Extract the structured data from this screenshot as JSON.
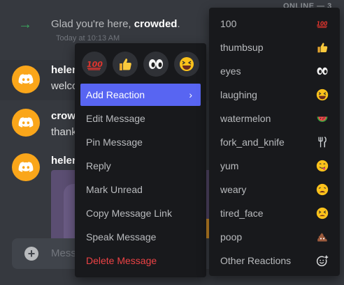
{
  "channel": {
    "online_header": "ONLINE — 3",
    "system_message": {
      "prefix": "Glad you're here, ",
      "username": "crowded",
      "suffix": ".",
      "timestamp": "Today at 10:13 AM"
    },
    "messages": [
      {
        "author": "helen",
        "body": "welco"
      },
      {
        "author": "crow",
        "body": "thank"
      },
      {
        "author": "heler",
        "body": ""
      }
    ],
    "composer_placeholder": "Messa"
  },
  "context_menu": {
    "quick_reactions": [
      "100-emoji",
      "thumbsup-emoji",
      "eyes-emoji",
      "laughing-emoji"
    ],
    "items": [
      {
        "label": "Add Reaction",
        "active": true,
        "has_submenu": true
      },
      {
        "label": "Edit Message"
      },
      {
        "label": "Pin Message"
      },
      {
        "label": "Reply"
      },
      {
        "label": "Mark Unread"
      },
      {
        "label": "Copy Message Link"
      },
      {
        "label": "Speak Message"
      },
      {
        "label": "Delete Message",
        "danger": true
      }
    ]
  },
  "reaction_submenu": {
    "items": [
      {
        "label": "100",
        "icon": "100-emoji"
      },
      {
        "label": "thumbsup",
        "icon": "thumbsup-emoji"
      },
      {
        "label": "eyes",
        "icon": "eyes-emoji"
      },
      {
        "label": "laughing",
        "icon": "laughing-emoji"
      },
      {
        "label": "watermelon",
        "icon": "watermelon-emoji"
      },
      {
        "label": "fork_and_knife",
        "icon": "fork-and-knife-emoji"
      },
      {
        "label": "yum",
        "icon": "yum-emoji"
      },
      {
        "label": "weary",
        "icon": "weary-emoji"
      },
      {
        "label": "tired_face",
        "icon": "tired-face-emoji"
      },
      {
        "label": "poop",
        "icon": "poop-emoji"
      },
      {
        "label": "Other Reactions",
        "icon": "add-reaction-icon"
      }
    ]
  },
  "colors": {
    "background": "#36393f",
    "menu": "#18191c",
    "accent": "#5865f2",
    "danger": "#ed4245",
    "avatar": "#faa61a",
    "join_arrow": "#3ba55d"
  }
}
